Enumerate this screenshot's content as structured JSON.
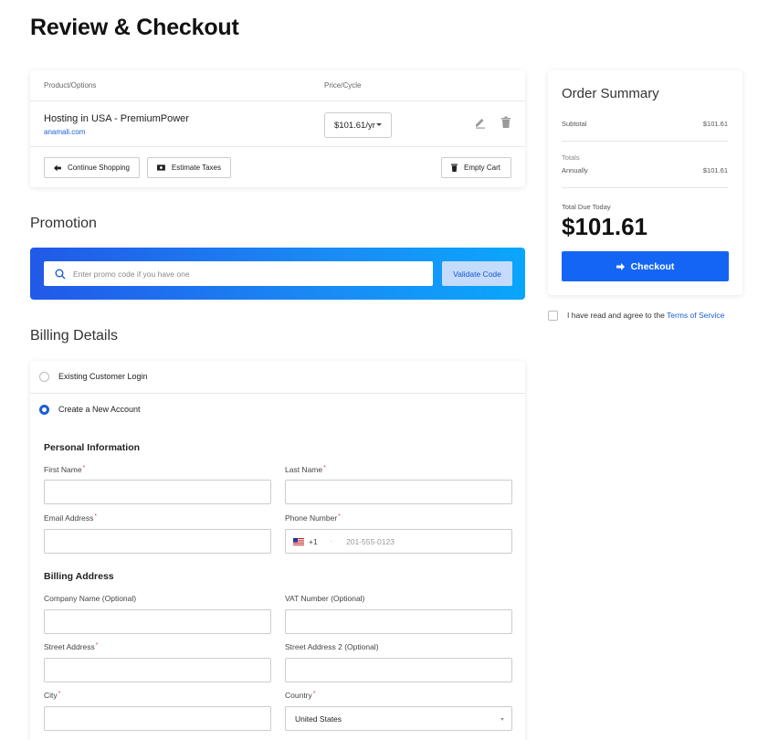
{
  "page": {
    "title": "Review & Checkout"
  },
  "cart": {
    "col_product": "Product/Options",
    "col_price": "Price/Cycle",
    "item": {
      "name": "Hosting in USA - PremiumPower",
      "domain": "anamali.com",
      "price": "$101.61/yr"
    },
    "actions": {
      "continue": "Continue Shopping",
      "taxes": "Estimate Taxes",
      "empty": "Empty Cart"
    }
  },
  "promo": {
    "title": "Promotion",
    "placeholder": "Enter promo code if you have one",
    "validate": "Validate Code"
  },
  "billing": {
    "title": "Billing Details",
    "existing_login": "Existing Customer Login",
    "create_account": "Create a New Account",
    "selected_option": "Create a New Account",
    "personal_title": "Personal Information",
    "first_name": "First Name",
    "last_name": "Last Name",
    "email": "Email Address",
    "phone": "Phone Number",
    "phone_code": "+1",
    "phone_placeholder": "201-555-0123",
    "address_title": "Billing Address",
    "company": "Company Name (Optional)",
    "vat": "VAT Number (Optional)",
    "street": "Street Address",
    "street2": "Street Address 2 (Optional)",
    "city": "City",
    "country": "Country",
    "country_value": "United States",
    "required_mark": "*"
  },
  "summary": {
    "title": "Order Summary",
    "subtotal_label": "Subtotal",
    "subtotal_value": "$101.61",
    "totals_label": "Totals",
    "annually_label": "Annually",
    "annually_value": "$101.61",
    "total_due_label": "Total Due Today",
    "total_due_value": "$101.61",
    "checkout": "Checkout"
  },
  "terms": {
    "text": "I have read and agree to the",
    "link": "Terms of Service",
    "checked": false
  },
  "colors": {
    "accent": "#1565f4",
    "link": "#1a5fd6",
    "required": "#e04b4b"
  }
}
